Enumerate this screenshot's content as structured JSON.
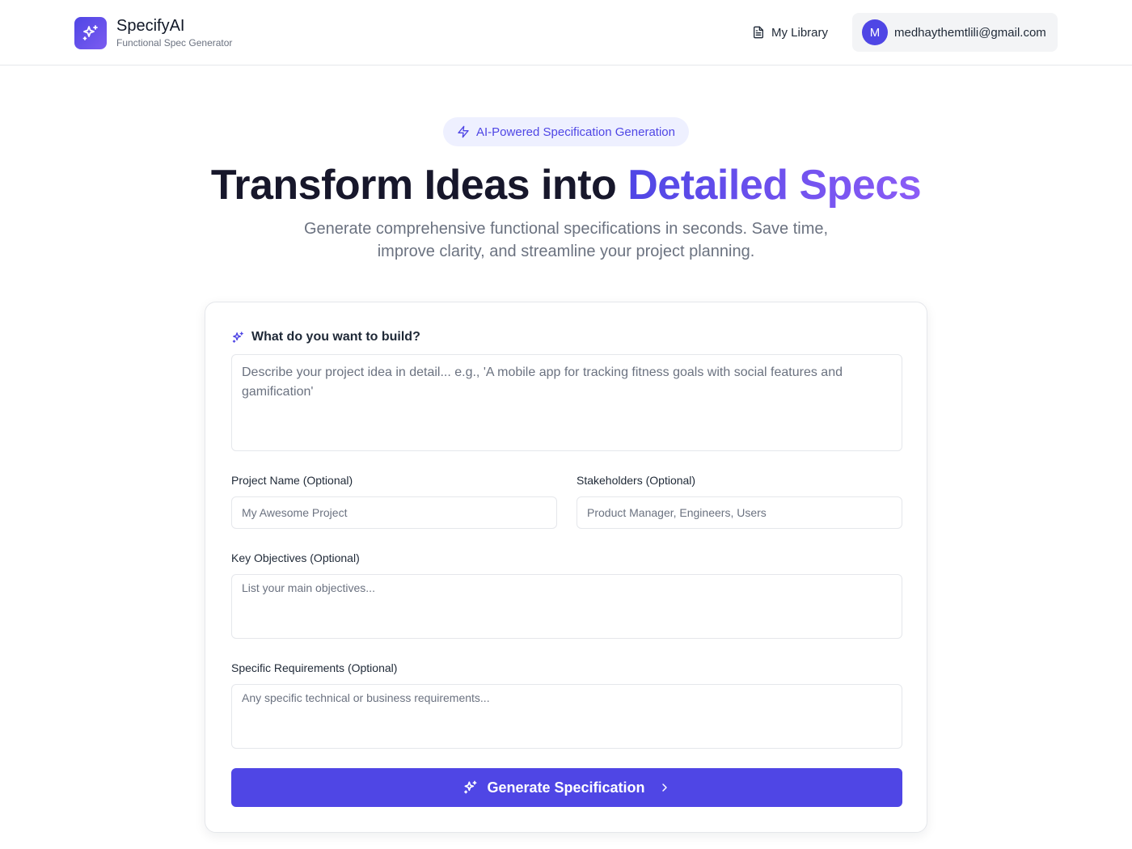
{
  "header": {
    "brand_name": "SpecifyAI",
    "brand_tagline": "Functional Spec Generator",
    "library_label": "My Library",
    "user_initial": "M",
    "user_email": "medhaythemtlili@gmail.com"
  },
  "hero": {
    "pill_label": "AI-Powered Specification Generation",
    "title_main": "Transform Ideas into ",
    "title_accent": "Detailed Specs",
    "subtitle": "Generate comprehensive functional specifications in seconds. Save time, improve clarity, and streamline your project planning."
  },
  "form": {
    "idea_label": "What do you want to build?",
    "idea_placeholder": "Describe your project idea in detail... e.g., 'A mobile app for tracking fitness goals with social features and gamification'",
    "project_name_label": "Project Name (Optional)",
    "project_name_placeholder": "My Awesome Project",
    "stakeholders_label": "Stakeholders (Optional)",
    "stakeholders_placeholder": "Product Manager, Engineers, Users",
    "objectives_label": "Key Objectives (Optional)",
    "objectives_placeholder": "List your main objectives...",
    "requirements_label": "Specific Requirements (Optional)",
    "requirements_placeholder": "Any specific technical or business requirements...",
    "submit_label": "Generate Specification"
  },
  "colors": {
    "accent": "#4f46e5",
    "accent_light": "#8b5cf6",
    "pill_bg": "#eef0ff"
  },
  "icons": {
    "brand": "sparkles-icon",
    "library": "document-icon",
    "pill": "lightning-icon",
    "idea": "sparkles-icon",
    "submit": "sparkles-icon",
    "submit_trailing": "chevron-right-icon"
  }
}
